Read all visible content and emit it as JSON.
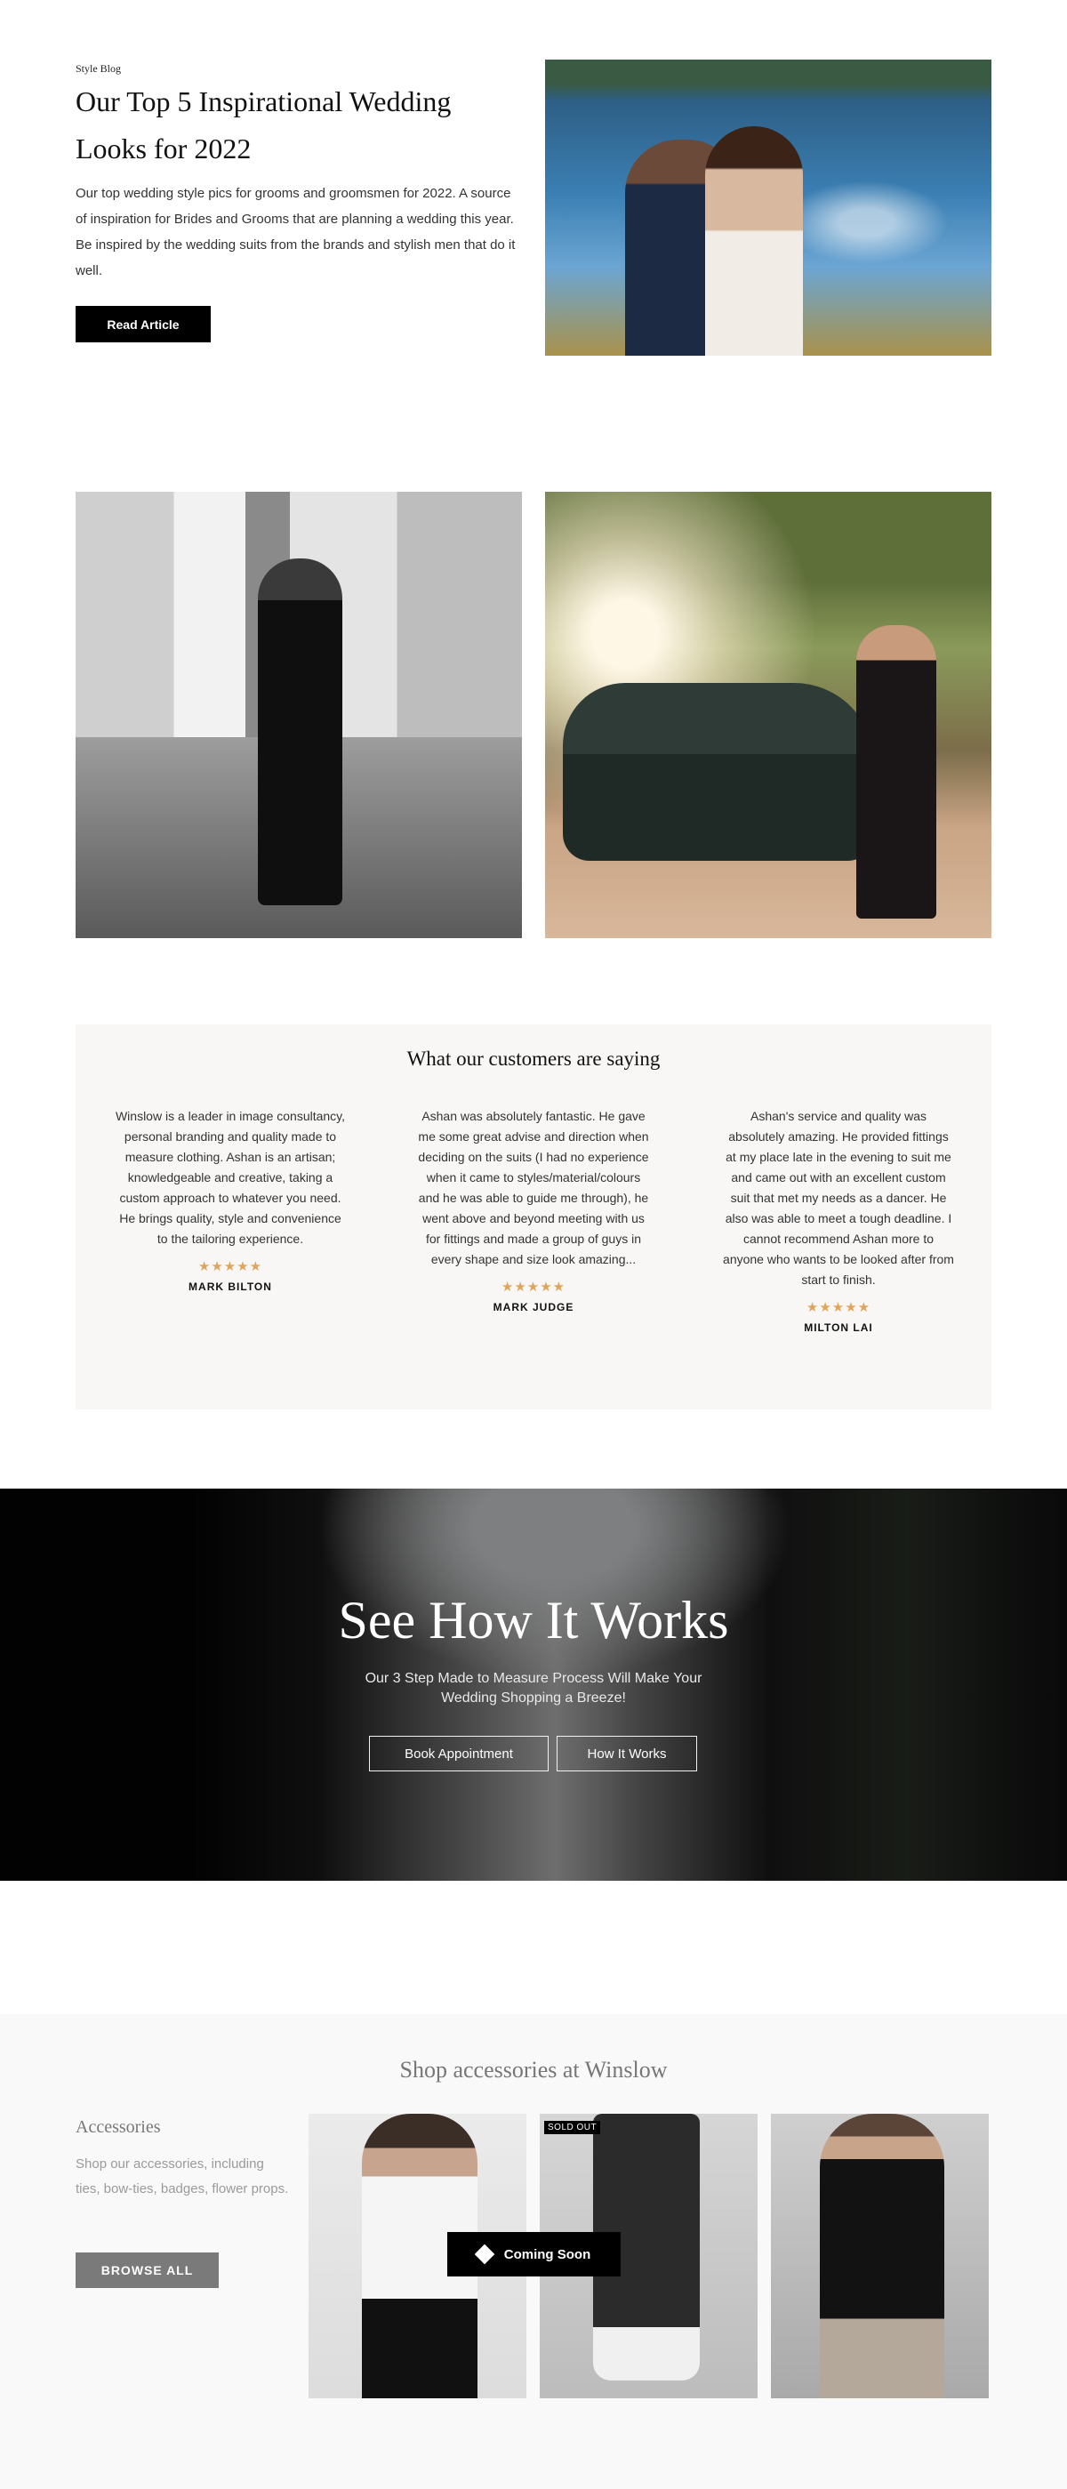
{
  "article": {
    "kicker": "Style Blog",
    "title": "Our Top 5 Inspirational Wedding Looks for 2022",
    "description": "Our top wedding style pics for grooms and groomsmen for 2022. A source of inspiration for Brides and Grooms that are planning a wedding this year. Be inspired by the wedding suits from the brands and stylish men that do it well.",
    "cta": "Read Article"
  },
  "testimonials": {
    "title": "What our customers are saying",
    "items": [
      {
        "text": "Winslow is a leader in image consultancy, personal branding and quality made to measure clothing. Ashan is an artisan; knowledgeable and creative, taking a custom approach to whatever you need. He brings quality, style and convenience to the tailoring experience.",
        "stars": "★★★★★",
        "name": "MARK BILTON"
      },
      {
        "text": "Ashan was absolutely fantastic. He gave me some great advise and direction when deciding on the suits (I had no experience when it came to styles/material/colours and he was able to guide me through), he went above and beyond meeting with us for fittings and made a group of guys in every shape and size look amazing...",
        "stars": "★★★★★",
        "name": "MARK JUDGE"
      },
      {
        "text": "Ashan's service and quality was absolutely amazing. He provided fittings at my place late in the evening to suit me and came out with an excellent custom suit that met my needs as a dancer. He also was able to meet a tough deadline. I cannot recommend Ashan more to anyone who wants to be looked after from start to finish.",
        "stars": "★★★★★",
        "name": "MILTON LAI"
      }
    ]
  },
  "hero": {
    "title": "See How It Works",
    "subtitle": "Our 3 Step Made to Measure Process Will Make Your Wedding Shopping a Breeze!",
    "buttons": [
      "Book Appointment",
      "How It Works"
    ]
  },
  "accessories": {
    "title": "Shop accessories at Winslow",
    "subtitle": "Accessories",
    "description": "Shop our accessories, including ties, bow-ties, badges, flower props.",
    "cta": "BROWSE ALL",
    "sold_out": "SOLD OUT",
    "coming_soon": "Coming Soon"
  },
  "colors": {
    "star": "#e0a45a",
    "testimonial_bg": "#f8f7f6",
    "button_dark": "#000000",
    "button_grey": "#7a7a7a"
  }
}
